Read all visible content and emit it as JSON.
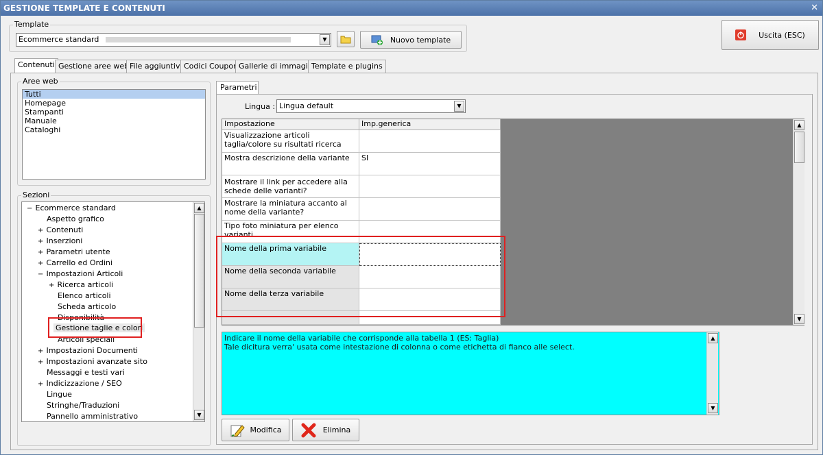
{
  "window": {
    "title": "GESTIONE TEMPLATE E CONTENUTI",
    "close": "✕"
  },
  "template": {
    "legend": "Template",
    "selected": "Ecommerce standard",
    "new_button": "Nuovo template"
  },
  "exit_button": "Uscita (ESC)",
  "tabs": [
    "Contenuti",
    "Gestione aree web",
    "File aggiuntivi",
    "Codici Coupon",
    "Gallerie di immagini",
    "Template e plugins"
  ],
  "aree_web": {
    "legend": "Aree web",
    "items": [
      "Tutti",
      "Homepage",
      "Stampanti",
      "Manuale",
      "Cataloghi"
    ]
  },
  "sezioni": {
    "legend": "Sezioni",
    "items": [
      {
        "label": "Ecommerce standard",
        "exp": "−"
      },
      {
        "label": "Aspetto grafico",
        "exp": ""
      },
      {
        "label": "Contenuti",
        "exp": "+"
      },
      {
        "label": "Inserzioni",
        "exp": "+"
      },
      {
        "label": "Parametri utente",
        "exp": "+"
      },
      {
        "label": "Carrello ed Ordini",
        "exp": "+"
      },
      {
        "label": "Impostazioni Articoli",
        "exp": "−"
      },
      {
        "label": "Ricerca articoli",
        "exp": "+"
      },
      {
        "label": "Elenco articoli",
        "exp": ""
      },
      {
        "label": "Scheda articolo",
        "exp": ""
      },
      {
        "label": "Disponibilità",
        "exp": ""
      },
      {
        "label": "Gestione taglie e colori",
        "exp": ""
      },
      {
        "label": "Articoli speciali",
        "exp": ""
      },
      {
        "label": "Impostazioni Documenti",
        "exp": "+"
      },
      {
        "label": "Impostazioni avanzate sito",
        "exp": "+"
      },
      {
        "label": "Messaggi e testi vari",
        "exp": ""
      },
      {
        "label": "Indicizzazione / SEO",
        "exp": "+"
      },
      {
        "label": "Lingue",
        "exp": ""
      },
      {
        "label": "Stringhe/Traduzioni",
        "exp": ""
      },
      {
        "label": "Pannello amministrativo",
        "exp": ""
      }
    ]
  },
  "parametri": {
    "tab": "Parametri",
    "lingua_label": "Lingua :",
    "lingua_value": "Lingua default",
    "columns": [
      "Impostazione",
      "Imp.generica"
    ],
    "rows": [
      {
        "name": "Visualizzazione articoli taglia/colore su risultati ricerca",
        "value": ""
      },
      {
        "name": "Mostra descrizione della variante",
        "value": "SI"
      },
      {
        "name": "Mostrare il link per accedere alla schede delle varianti?",
        "value": ""
      },
      {
        "name": "Mostrare la miniatura accanto al nome della variante?",
        "value": ""
      },
      {
        "name": "Tipo foto miniatura per elenco varianti",
        "value": ""
      },
      {
        "name": "Nome della prima variabile",
        "value": ""
      },
      {
        "name": "Nome della seconda variabile",
        "value": ""
      },
      {
        "name": "Nome della terza variabile",
        "value": ""
      }
    ],
    "description": "Indicare il nome della variabile che corrisponde alla tabella 1 (ES: Taglia)\nTale dicitura verra' usata come intestazione di colonna o come etichetta di fianco alle select.",
    "modifica": "Modifica",
    "elimina": "Elimina"
  },
  "colors": {
    "title_bar": "#4c71a8",
    "selected_row": "#b4f4f4",
    "description_bg": "#00ffff",
    "highlight": "#e02020"
  }
}
